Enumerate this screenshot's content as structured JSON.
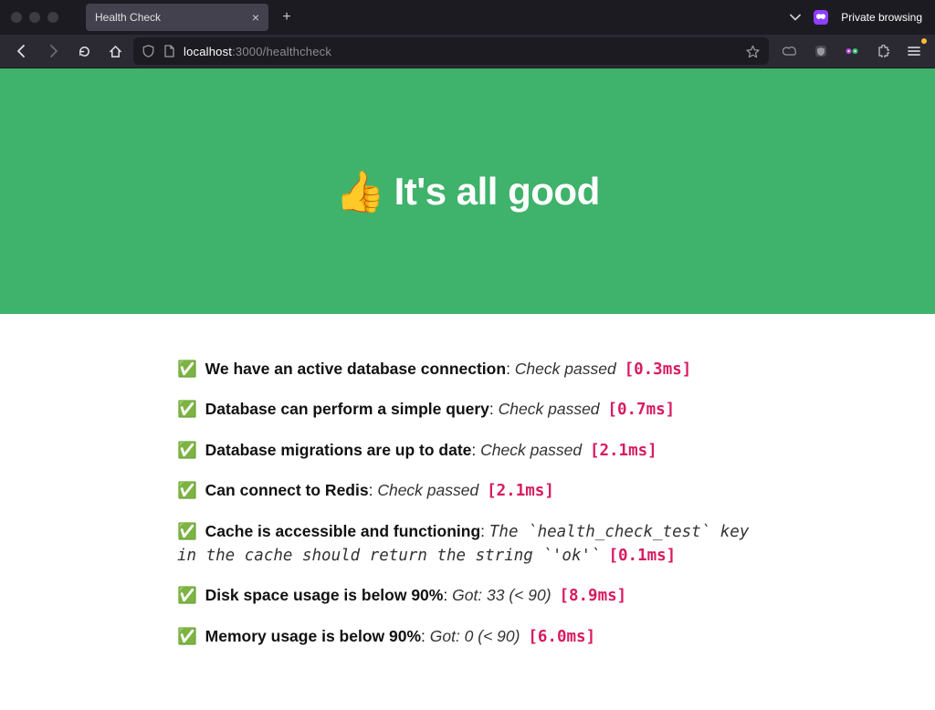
{
  "browser": {
    "tab_title": "Health Check",
    "private_label": "Private browsing",
    "url": {
      "host_main": "localhost",
      "host_rest": ":3000/healthcheck"
    }
  },
  "page": {
    "hero_emoji": "👍",
    "hero_text": "It's all good",
    "checks": [
      {
        "emoji": "✅",
        "title": "We have an active database connection",
        "sep": ": ",
        "desc": "Check passed",
        "timing": "[0.3ms]"
      },
      {
        "emoji": "✅",
        "title": "Database can perform a simple query",
        "sep": ": ",
        "desc": "Check passed",
        "timing": "[0.7ms]"
      },
      {
        "emoji": "✅",
        "title": "Database migrations are up to date",
        "sep": ": ",
        "desc": "Check passed",
        "timing": "[2.1ms]"
      },
      {
        "emoji": "✅",
        "title": "Can connect to Redis",
        "sep": ": ",
        "desc": "Check passed",
        "timing": "[2.1ms]"
      },
      {
        "emoji": "✅",
        "title": "Cache is accessible and functioning",
        "sep": ": ",
        "desc": "The `health_check_test` key in the cache should return the string `'ok'`",
        "timing": "[0.1ms]"
      },
      {
        "emoji": "✅",
        "title": "Disk space usage is below 90%",
        "sep": ": ",
        "desc": "Got: 33 (< 90)",
        "timing": "[8.9ms]"
      },
      {
        "emoji": "✅",
        "title": "Memory usage is below 90%",
        "sep": ": ",
        "desc": "Got: 0 (< 90)",
        "timing": "[6.0ms]"
      }
    ]
  },
  "colors": {
    "hero_bg": "#3fb26b",
    "timing": "#d81b60"
  }
}
